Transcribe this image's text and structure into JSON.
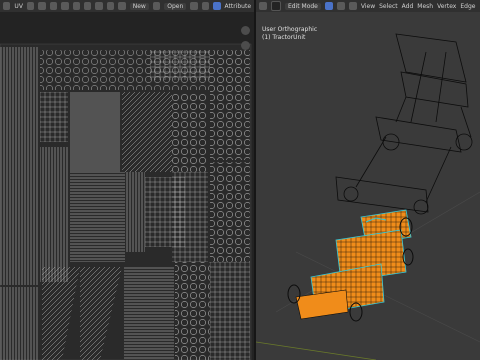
{
  "uv_header": {
    "editor_icon": "uv-editor-icon",
    "mode_label": "UV",
    "sync_icon": "uv-sync-icon",
    "select_icons": [
      "vertex-select-icon",
      "edge-select-icon",
      "face-select-icon",
      "island-select-icon"
    ],
    "new_label": "New",
    "open_label": "Open",
    "pin_icon": "pin-icon",
    "attribute_label": "Attribute"
  },
  "v3d_header": {
    "editor_icon": "viewport-editor-icon",
    "mode_label": "Edit Mode",
    "menus": [
      "View",
      "Select",
      "Add",
      "Mesh",
      "Vertex",
      "Edge"
    ]
  },
  "v3d_overlay": {
    "view_name": "User Orthographic",
    "object_name": "(1) TractorUnit"
  },
  "colors": {
    "selection": "#f08c1a",
    "active": "#34c8d8",
    "wire": "#0a0a0a",
    "uv_wire": "#cfcfcf"
  }
}
